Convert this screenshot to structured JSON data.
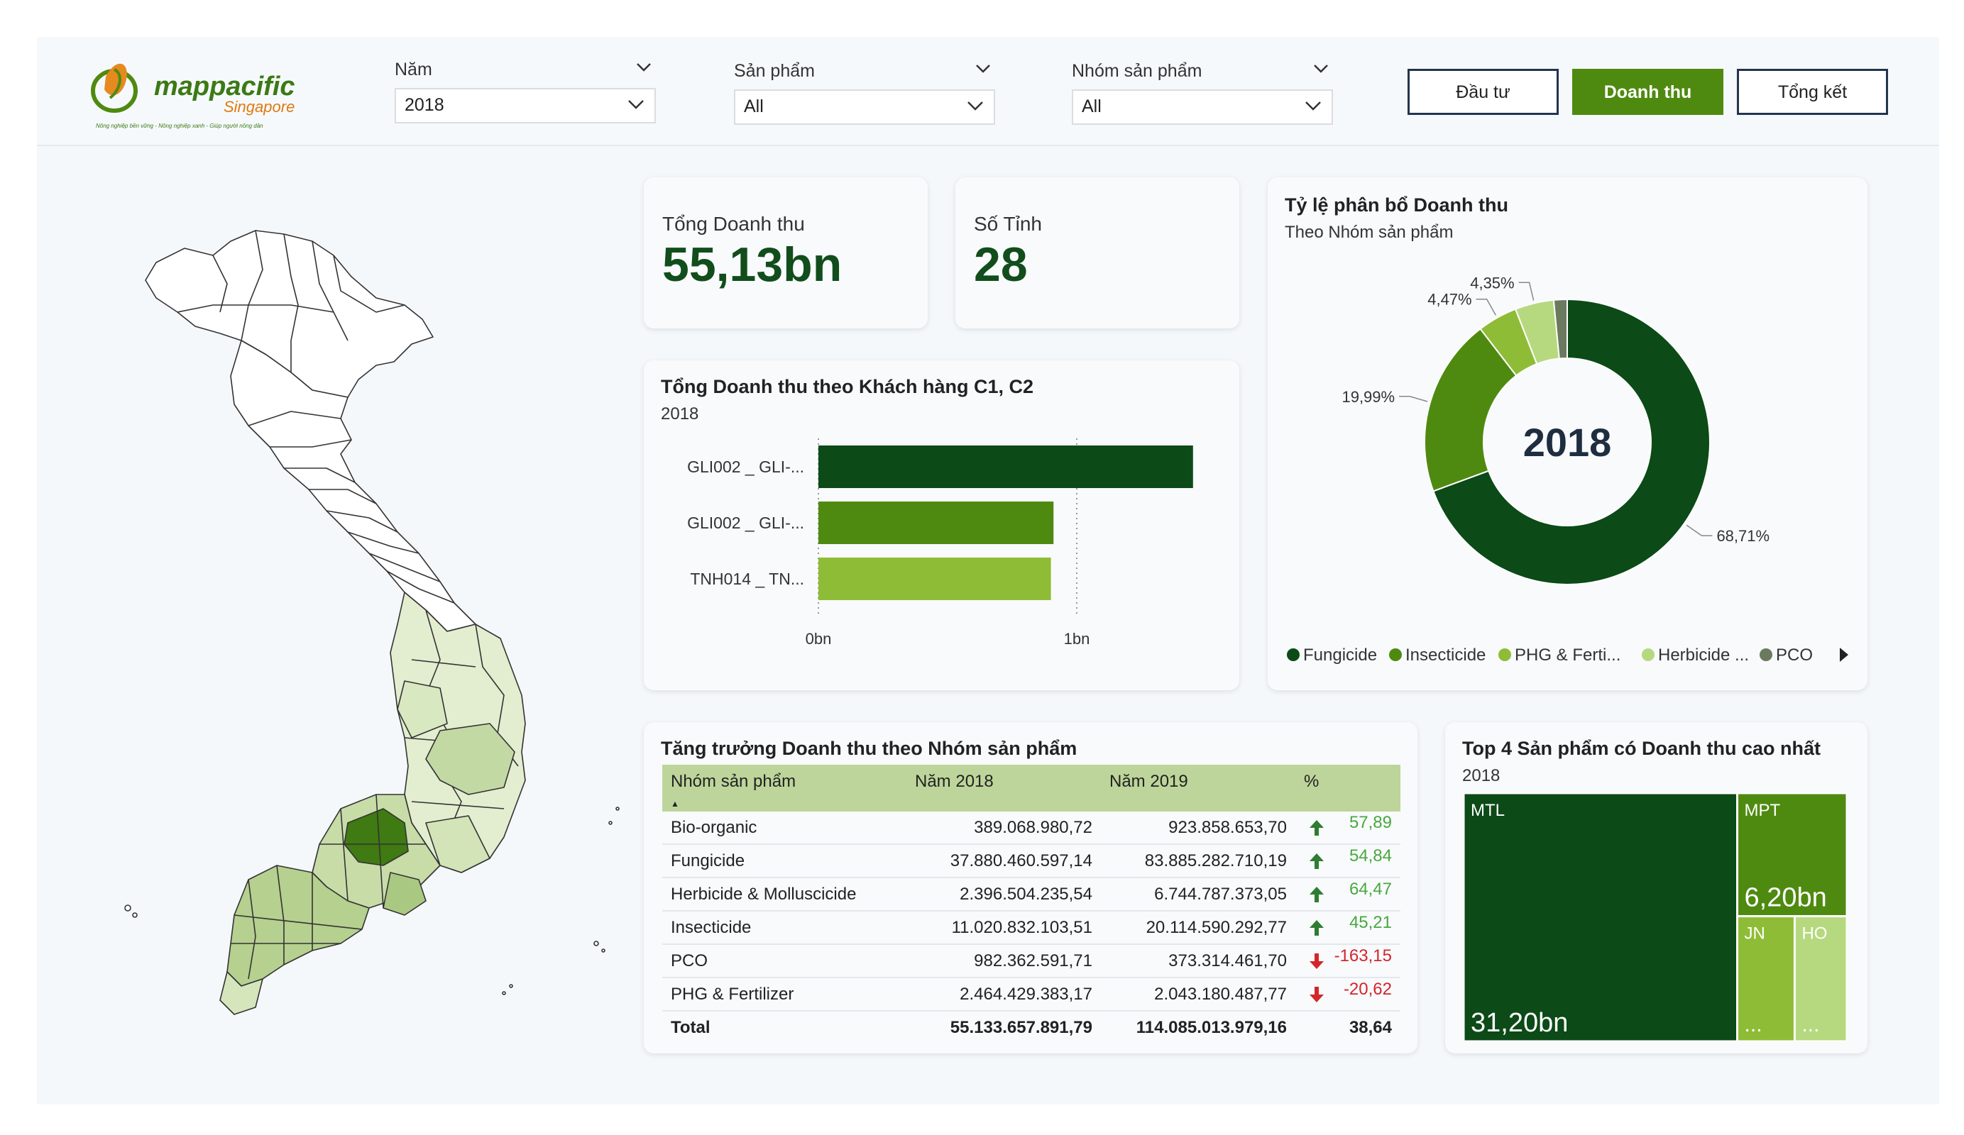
{
  "brand": {
    "logo_name": "mappacific",
    "logo_sub": "Singapore",
    "tagline": "Nông nghiệp bền vững - Nông nghiệp xanh - Giúp người nông dân"
  },
  "filters": [
    {
      "label": "Năm",
      "value": "2018"
    },
    {
      "label": "Sản phẩm",
      "value": "All"
    },
    {
      "label": "Nhóm sản phẩm",
      "value": "All"
    }
  ],
  "nav": {
    "invest": "Đầu tư",
    "revenue": "Doanh thu",
    "summary": "Tổng kết"
  },
  "kpi": {
    "revenue_label": "Tổng Doanh thu",
    "revenue_value": "55,13bn",
    "provinces_label": "Số Tỉnh",
    "provinces_value": "28"
  },
  "customers": {
    "title": "Tổng Doanh thu theo Khách hàng C1, C2",
    "subtitle": "2018"
  },
  "share": {
    "title": "Tỷ lệ phân bổ Doanh thu",
    "subtitle": "Theo Nhóm sản phẩm",
    "center": "2018"
  },
  "growth": {
    "title": "Tăng trưởng Doanh thu theo Nhóm sản phẩm",
    "headers": [
      "Nhóm sản phẩm",
      "Năm 2018",
      "Năm 2019",
      "%"
    ],
    "rows": [
      {
        "group": "Bio-organic",
        "y2018": "389.068.980,72",
        "y2019": "923.858.653,70",
        "pct": "57,89",
        "dir": "up"
      },
      {
        "group": "Fungicide",
        "y2018": "37.880.460.597,14",
        "y2019": "83.885.282.710,19",
        "pct": "54,84",
        "dir": "up"
      },
      {
        "group": "Herbicide & Molluscicide",
        "y2018": "2.396.504.235,54",
        "y2019": "6.744.787.373,05",
        "pct": "64,47",
        "dir": "up"
      },
      {
        "group": "Insecticide",
        "y2018": "11.020.832.103,51",
        "y2019": "20.114.590.292,77",
        "pct": "45,21",
        "dir": "up"
      },
      {
        "group": "PCO",
        "y2018": "982.362.591,71",
        "y2019": "373.314.461,70",
        "pct": "-163,15",
        "dir": "down"
      },
      {
        "group": "PHG & Fertilizer",
        "y2018": "2.464.429.383,17",
        "y2019": "2.043.180.487,77",
        "pct": "-20,62",
        "dir": "down"
      }
    ],
    "total": {
      "group": "Total",
      "y2018": "55.133.657.891,79",
      "y2019": "114.085.013.979,16",
      "pct": "38,64"
    }
  },
  "top": {
    "title": "Top 4 Sản phẩm có Doanh thu cao nhất",
    "subtitle": "2018"
  },
  "chart_data": [
    {
      "type": "bar",
      "orientation": "horizontal",
      "categories": [
        "GLI002 _ GLI-...",
        "GLI002 _ GLI-...",
        "TNH014 _ TN..."
      ],
      "values": [
        1.45,
        0.91,
        0.9
      ],
      "colors": [
        "#0c4a17",
        "#4f8a10",
        "#8fbc36"
      ],
      "tick_labels": [
        "0bn",
        "1bn"
      ],
      "xlim": [
        0,
        1
      ]
    },
    {
      "type": "pie",
      "categories": [
        "Fungicide",
        "Insecticide",
        "PHG & Ferti...",
        "Herbicide ...",
        "PCO"
      ],
      "values": [
        68.71,
        19.99,
        4.47,
        4.35,
        1.5
      ],
      "labels": [
        "68,71%",
        "19,99%",
        "4,47%",
        "4,35%",
        ""
      ],
      "colors": [
        "#0c4a17",
        "#4f8a10",
        "#8fbc36",
        "#b6d97f",
        "#6b7a5e"
      ]
    },
    {
      "type": "treemap",
      "categories": [
        "MTL",
        "MPT",
        "JN",
        "HO"
      ],
      "values": [
        31.2,
        6.2,
        3.3,
        3.0
      ],
      "value_labels": [
        "31,20bn",
        "6,20bn",
        "...",
        "..."
      ],
      "colors": [
        "#0c4a17",
        "#4f8a10",
        "#8fbc36",
        "#b6d97f"
      ]
    }
  ]
}
